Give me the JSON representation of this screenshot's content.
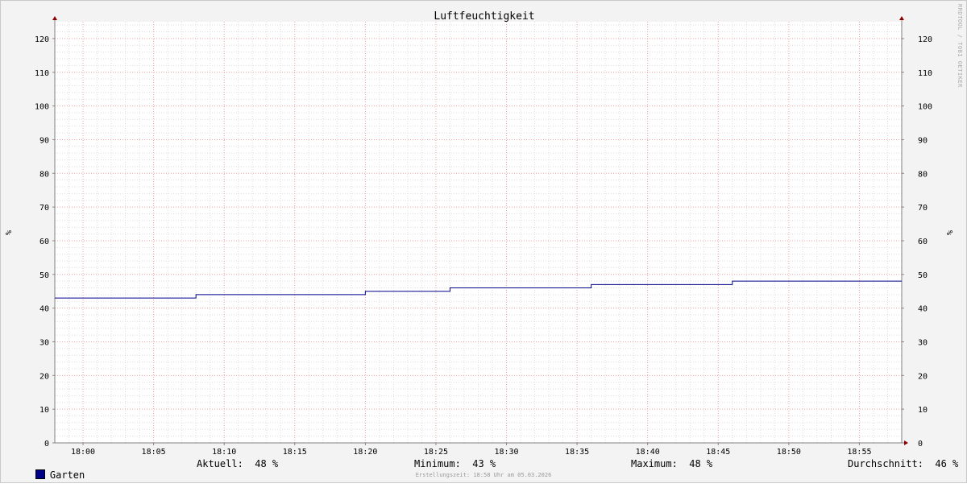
{
  "chart_data": {
    "type": "line",
    "title": "Luftfeuchtigkeit",
    "ylabel": "%",
    "ylim": [
      0,
      125
    ],
    "yticks": [
      0,
      10,
      20,
      30,
      40,
      50,
      60,
      70,
      80,
      90,
      100,
      110,
      120
    ],
    "xlim": [
      "17:58",
      "18:58"
    ],
    "xticks": [
      "18:00",
      "18:05",
      "18:10",
      "18:15",
      "18:20",
      "18:25",
      "18:30",
      "18:35",
      "18:40",
      "18:45",
      "18:50",
      "18:55"
    ],
    "grid": true,
    "series": [
      {
        "name": "Garten",
        "color": "#00008b",
        "step": true,
        "x": [
          "17:58",
          "18:08",
          "18:20",
          "18:26",
          "18:36",
          "18:46",
          "18:58"
        ],
        "values": [
          43,
          44,
          45,
          46,
          47,
          48,
          48
        ]
      }
    ]
  },
  "legend": {
    "series_name": "Garten",
    "aktuell": "Aktuell:  48 %",
    "minimum": "Minimum:  43 %",
    "maximum": "Maximum:  48 %",
    "durchschnitt": "Durchschnitt:  46 %"
  },
  "footer": "Erstellungszeit: 18:58 Uhr am 05.03.2026",
  "watermark": "RRDTOOL / TOBI OETIKER"
}
